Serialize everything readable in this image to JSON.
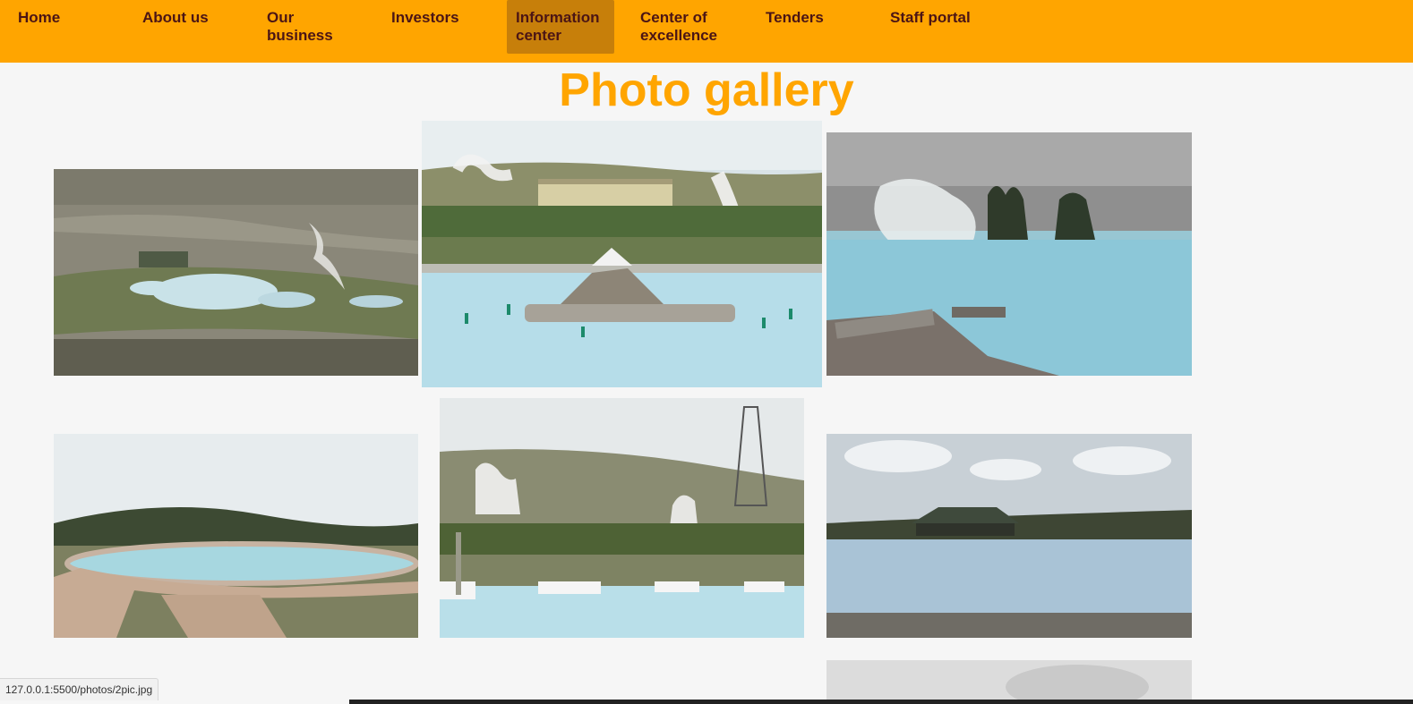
{
  "nav": {
    "items": [
      {
        "label": "Home"
      },
      {
        "label": "About us"
      },
      {
        "label": "Our business"
      },
      {
        "label": "Investors"
      },
      {
        "label": "Information center",
        "active": true
      },
      {
        "label": "Center of excellence"
      },
      {
        "label": "Tenders"
      },
      {
        "label": "Staff portal"
      }
    ]
  },
  "page": {
    "title": "Photo gallery"
  },
  "gallery": {
    "photos": [
      {
        "subject": "aerial view of geothermal spa pools"
      },
      {
        "subject": "blue pool with rock fountain and power station"
      },
      {
        "subject": "steaming blue geothermal lake"
      },
      {
        "subject": "circular pool with paved path"
      },
      {
        "subject": "power lines and steam vents over pool"
      },
      {
        "subject": "lakeside lodge with blue water"
      },
      {
        "subject": "cloudy sky (partially visible)"
      }
    ]
  },
  "status": {
    "url": "127.0.0.1:5500/photos/2pic.jpg"
  },
  "colors": {
    "accent": "#ffa500",
    "nav_text": "#4b1515",
    "active_tab": "#c77f0a"
  }
}
